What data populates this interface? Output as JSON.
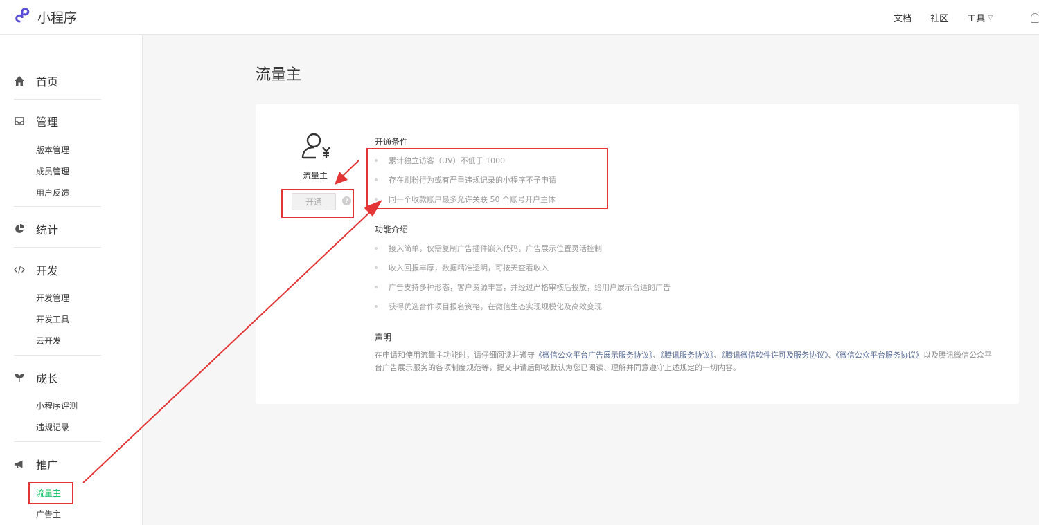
{
  "header": {
    "brand": "小程序",
    "nav": {
      "docs": "文档",
      "community": "社区",
      "tools": "工具"
    }
  },
  "sidebar": {
    "home": "首页",
    "manage": {
      "label": "管理",
      "items": [
        "版本管理",
        "成员管理",
        "用户反馈"
      ]
    },
    "stats": "统计",
    "dev": {
      "label": "开发",
      "items": [
        "开发管理",
        "开发工具",
        "云开发"
      ]
    },
    "growth": {
      "label": "成长",
      "items": [
        "小程序评测",
        "违规记录"
      ]
    },
    "promo": {
      "label": "推广",
      "items": [
        "流量主",
        "广告主"
      ],
      "active": "流量主"
    }
  },
  "main": {
    "title": "流量主",
    "role_name": "流量主",
    "open_button": "开通",
    "conditions": {
      "title": "开通条件",
      "items": [
        "累计独立访客（UV）不低于 1000",
        "存在刷粉行为或有严重违规记录的小程序不予申请",
        "同一个收款账户最多允许关联 50 个账号开户主体"
      ]
    },
    "features": {
      "title": "功能介绍",
      "items": [
        "接入简单，仅需复制广告插件嵌入代码，广告展示位置灵活控制",
        "收入回报丰厚，数据精准透明，可按天查看收入",
        "广告支持多种形态，客户资源丰富，并经过严格审核后投放，给用户展示合适的广告",
        "获得优选合作项目报名资格，在微信生态实现规模化及高效变现"
      ]
    },
    "statement": {
      "title": "声明",
      "prefix": "在申请和使用流量主功能时，请仔细阅读并遵守",
      "link1": "《微信公众平台广告展示服务协议》",
      "sep1": "、",
      "link2": "《腾讯服务协议》",
      "sep2": "、",
      "link3": "《腾讯微信软件许可及服务协议》",
      "sep3": "、",
      "link4": "《微信公众平台服务协议》",
      "suffix": "以及腾讯微信公众平台广告展示服务的各项制度规范等，提交申请后即被默认为您已阅读、理解并同意遵守上述规定的一切内容。"
    }
  },
  "colors": {
    "accent_green": "#07c160",
    "link_blue": "#576b95",
    "annotation_red": "#e33535"
  }
}
